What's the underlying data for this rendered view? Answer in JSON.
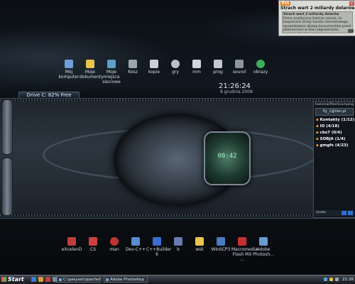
{
  "notification": {
    "badge": "RSS",
    "title": "Strach wart 2 miliardy dolarów...",
    "close": "x",
    "lines": [
      "Strach wart 2 miliardy dolarów",
      "Firma analityczna Gartner ocenia, że bezpieczne straty handlu internetowego, spowodowane obawą konsumentów przed płatnościami w Sieci zagrożeniami, wyniosły 2 miliardy dolarów."
    ]
  },
  "top_icons": [
    {
      "label": "Mój komputer",
      "color": "#6ea0d8"
    },
    {
      "label": "Moje dokumenty",
      "color": "#e8c44a"
    },
    {
      "label": "Moje miejsca sieciowe",
      "color": "#5aa0c8"
    },
    {
      "label": "Kosz",
      "color": "#9aa6b2"
    },
    {
      "label": "kopie",
      "color": "#c9d2dc"
    },
    {
      "label": "gry",
      "color": "#b8c2cc"
    },
    {
      "label": "mm",
      "color": "#d0d6dc"
    },
    {
      "label": "prog",
      "color": "#c0c8d0"
    },
    {
      "label": "sound",
      "color": "#8a96a2"
    },
    {
      "label": "obrazy",
      "color": "#3fae5a"
    }
  ],
  "clock": {
    "time": "21:26:24",
    "date": "8 grudnia 2008"
  },
  "drive": "Drive C: 82% Free",
  "gadu": {
    "menu": [
      "tools",
      "mail",
      "files",
      "forum",
      "ping"
    ],
    "user": "fly_1@tlen.pl",
    "groups": [
      {
        "name": "Kontakty",
        "count": "(1/12)"
      },
      {
        "name": "IO",
        "count": "(4/18)"
      },
      {
        "name": "cbs7",
        "count": "(0/4)"
      },
      {
        "name": "SOBJA",
        "count": "(1/4)"
      },
      {
        "name": "gmgfs",
        "count": "(4/23)"
      }
    ],
    "status": "studio"
  },
  "gauge_text": "00:42",
  "bottom_icons": [
    {
      "label": "eXcelenD",
      "color": "#c03c3c"
    },
    {
      "label": "CS",
      "color": "#d04040"
    },
    {
      "label": "man",
      "color": "#c03434"
    },
    {
      "label": "Dev-C++",
      "color": "#5a8ad0"
    },
    {
      "label": "C++Builder 6",
      "color": "#3a6ed0"
    },
    {
      "label": "b",
      "color": "#6a7ab0"
    },
    {
      "label": "wsk",
      "color": "#e8c44a"
    },
    {
      "label": "WinSCP3",
      "color": "#4a7ac0"
    },
    {
      "label": "Macromedia Flash MX ...",
      "color": "#c83030"
    },
    {
      "label": "Adobe Photosh...",
      "color": "#6a9ad0"
    }
  ],
  "taskbar": {
    "start": "Start",
    "tasks": [
      "C:\\pasyser\\zpachel\\...",
      "Adobe Photoshop"
    ],
    "time": "21:26"
  }
}
